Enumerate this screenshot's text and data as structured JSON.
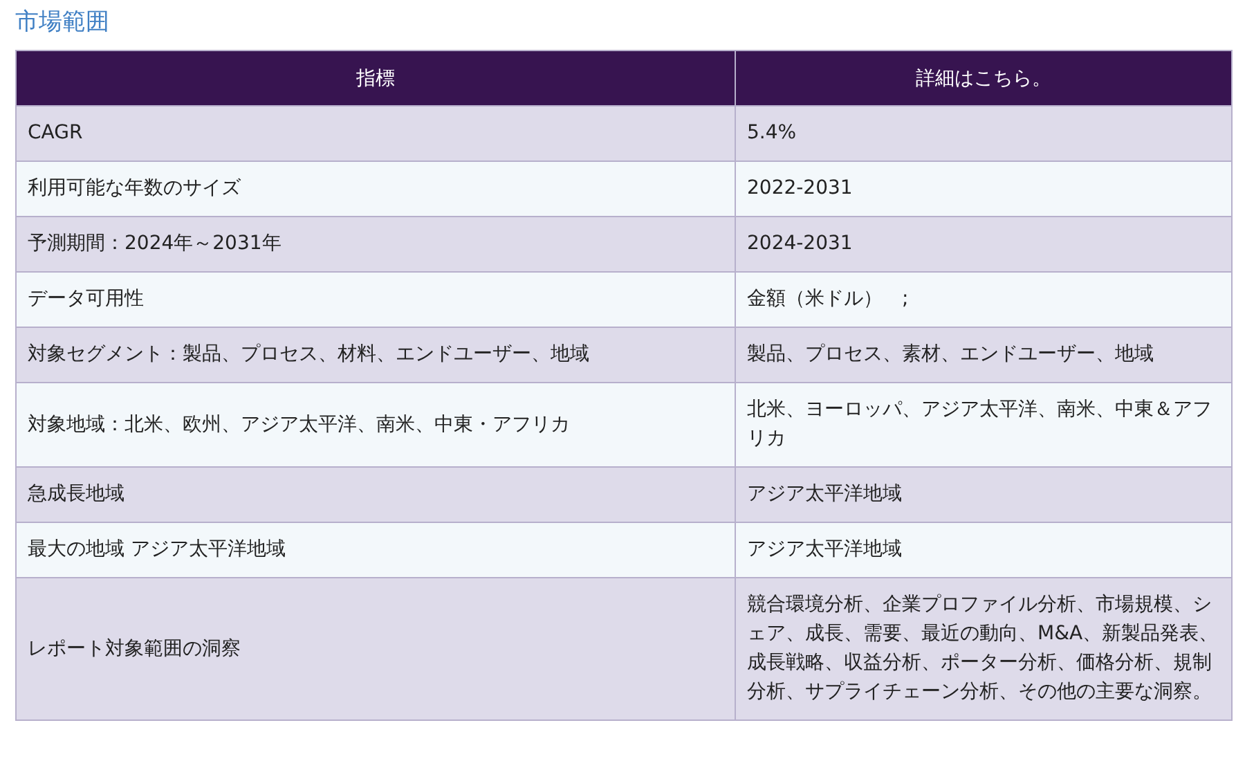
{
  "title": "市場範囲",
  "table": {
    "columns": [
      "指標",
      "詳細はこちら。"
    ],
    "rows": [
      [
        "CAGR",
        "5.4%"
      ],
      [
        "利用可能な年数のサイズ",
        "2022-2031"
      ],
      [
        "予測期間：2024年～2031年",
        "2024-2031"
      ],
      [
        "データ可用性",
        "金額（米ドル）　;"
      ],
      [
        "対象セグメント：製品、プロセス、材料、エンドユーザー、地域",
        "製品、プロセス、素材、エンドユーザー、地域"
      ],
      [
        "対象地域：北米、欧州、アジア太平洋、南米、中東・アフリカ",
        "北米、ヨーロッパ、アジア太平洋、南米、中東＆アフリカ"
      ],
      [
        "急成長地域",
        "アジア太平洋地域"
      ],
      [
        "最大の地域 アジア太平洋地域",
        "アジア太平洋地域"
      ],
      [
        "レポート対象範囲の洞察",
        "競合環境分析、企業プロファイル分析、市場規模、シェア、成長、需要、最近の動向、M&A、新製品発表、成長戦略、収益分析、ポーター分析、価格分析、規制分析、サプライチェーン分析、その他の主要な洞察。"
      ]
    ]
  }
}
